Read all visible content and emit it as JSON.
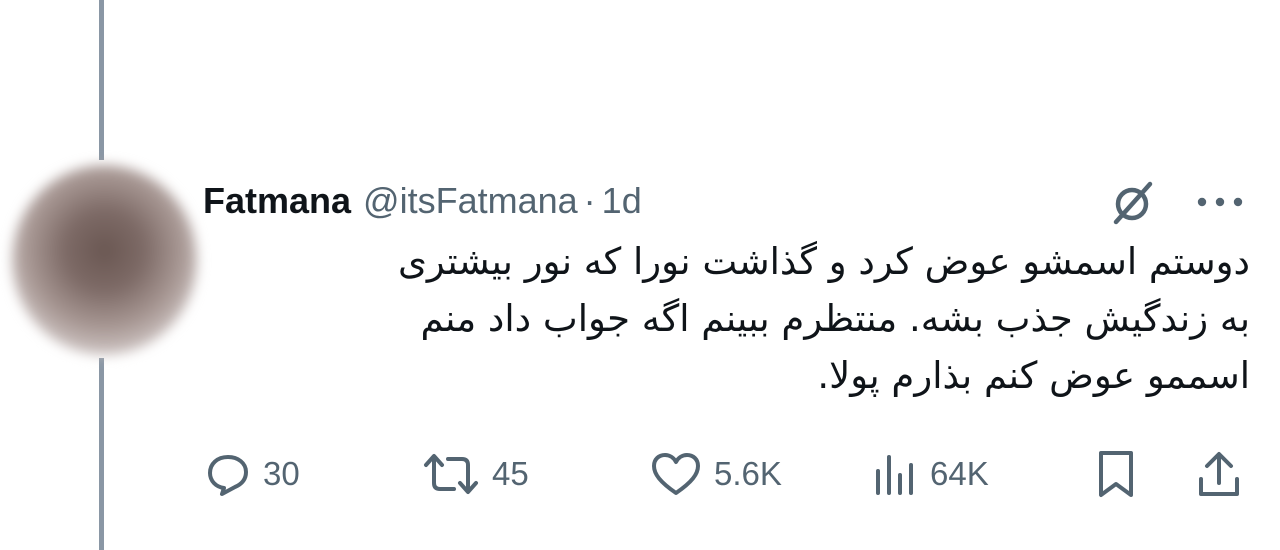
{
  "tweet": {
    "author_name": "Fatmana",
    "author_handle": "@itsFatmana",
    "separator": "·",
    "time": "1d",
    "text_lines": [
      "دوستم اسمشو عوض کرد و گذاشت نورا که نور بیشتری",
      "به زندگیش جذب بشه. منتظرم ببینم اگه جواب داد منم",
      "اسممو عوض کنم بذارم پولا."
    ]
  },
  "icons": {
    "grok": "grok-icon",
    "more": "more-options-icon",
    "reply": "reply-icon",
    "retweet": "retweet-icon",
    "like": "heart-icon",
    "views": "views-icon",
    "bookmark": "bookmark-icon",
    "share": "share-icon"
  },
  "actions": {
    "replies": "30",
    "reposts": "45",
    "likes": "5.6K",
    "views": "64K"
  },
  "colors": {
    "text_primary": "#0f1419",
    "text_secondary": "#536471",
    "thread_line": "#8a97a5"
  }
}
